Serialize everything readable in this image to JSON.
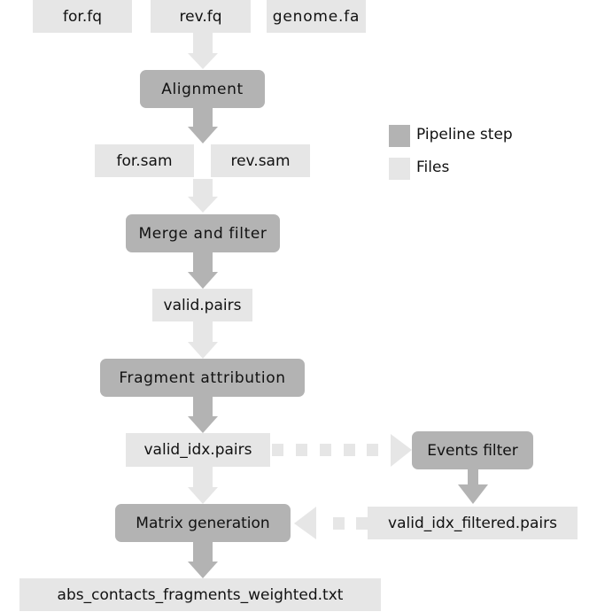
{
  "colors": {
    "step": "#b3b3b3",
    "file": "#e6e6e6",
    "text": "#111111"
  },
  "files": {
    "for_fq": "for.fq",
    "rev_fq": "rev.fq",
    "genome_fa": "genome.fa",
    "for_sam": "for.sam",
    "rev_sam": "rev.sam",
    "valid_pairs": "valid.pairs",
    "valid_idx_pairs": "valid_idx.pairs",
    "valid_idx_filtered_pairs": "valid_idx_filtered.pairs",
    "abs_contacts": "abs_contacts_fragments_weighted.txt"
  },
  "steps": {
    "alignment": "Alignment",
    "merge_filter": "Merge and filter",
    "fragment_attribution": "Fragment attribution",
    "events_filter": "Events filter",
    "matrix_generation": "Matrix generation"
  },
  "legend": {
    "step_label": "Pipeline step",
    "files_label": "Files"
  }
}
